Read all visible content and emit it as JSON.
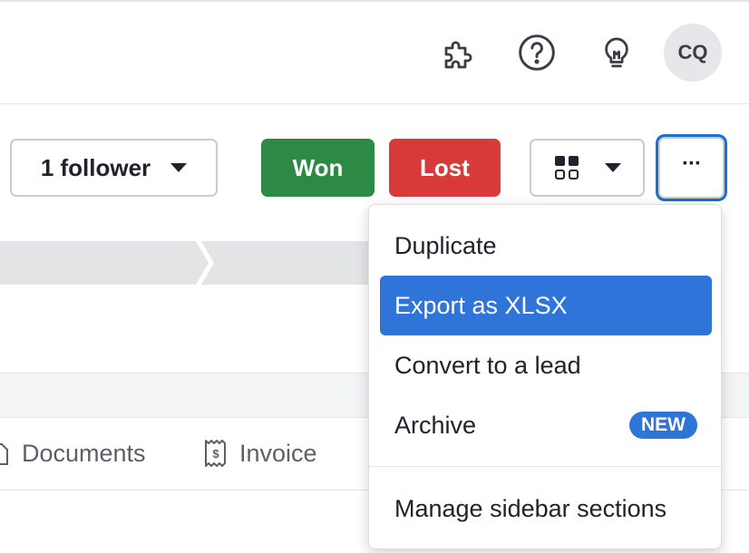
{
  "header": {
    "avatar_initials": "CQ",
    "icons": [
      "puzzle-icon",
      "help-icon",
      "lightbulb-icon"
    ]
  },
  "actions": {
    "follower_label": "1 follower",
    "won_label": "Won",
    "lost_label": "Lost",
    "more_label": "···"
  },
  "tabs": [
    {
      "label": "Documents",
      "icon": "document-icon"
    },
    {
      "label": "Invoice",
      "icon": "receipt-icon"
    }
  ],
  "menu": {
    "items": [
      {
        "label": "Duplicate"
      },
      {
        "label": "Export as XLSX",
        "active": true
      },
      {
        "label": "Convert to a lead"
      },
      {
        "label": "Archive",
        "badge": "NEW"
      }
    ],
    "footer_item": "Manage sidebar sections"
  },
  "colors": {
    "won": "#2d8a45",
    "lost": "#d83a3a",
    "accent": "#2e74d9",
    "focus_ring": "#1a6fd0"
  }
}
